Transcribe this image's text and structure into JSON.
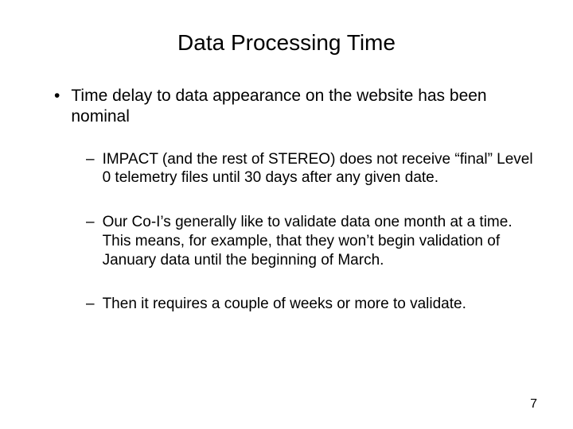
{
  "slide": {
    "title": "Data Processing Time",
    "bullets": [
      {
        "level": 1,
        "mark": "•",
        "text": "Time delay to data appearance on the website has been nominal"
      },
      {
        "level": 2,
        "mark": "–",
        "text": "IMPACT (and the rest of STEREO) does not receive “final” Level 0 telemetry files until 30 days after any given date."
      },
      {
        "level": 2,
        "mark": "–",
        "text": "Our Co-I’s generally like to validate data one month at a time. This means, for example, that they won’t begin validation of January data until the beginning of March."
      },
      {
        "level": 2,
        "mark": "–",
        "text": "Then it requires a couple of weeks or more to validate."
      }
    ],
    "page_number": "7"
  }
}
